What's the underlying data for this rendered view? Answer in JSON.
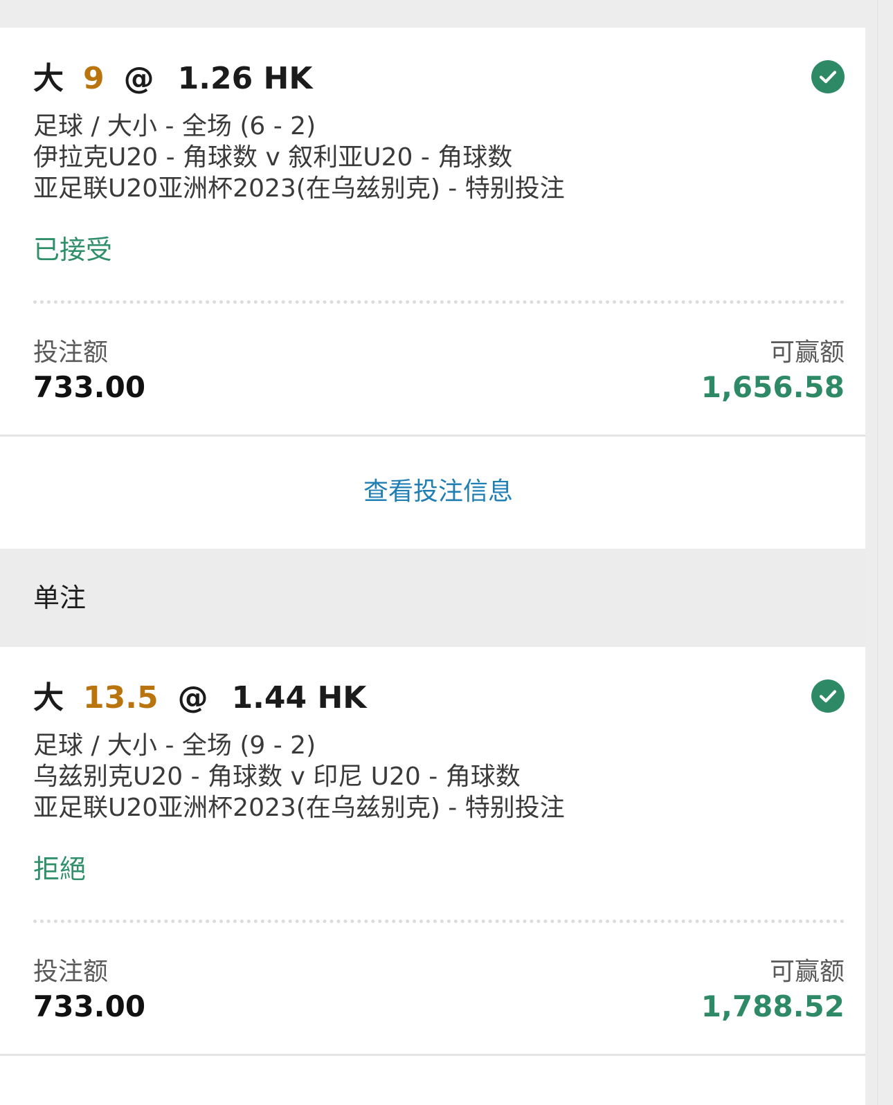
{
  "bets": [
    {
      "selection": "大",
      "line": "9",
      "at": "@",
      "odds": "1.26 HK",
      "desc_lines": [
        "足球 / 大小 - 全场 (6 - 2)",
        "伊拉克U20 - 角球数 v 叙利亚U20 - 角球数",
        "亚足联U20亚洲杯2023(在乌兹别克) - 特别投注"
      ],
      "status": "已接受",
      "stake_label": "投注额",
      "stake_value": "733.00",
      "win_label": "可赢额",
      "win_value": "1,656.58"
    },
    {
      "selection": "大",
      "line": "13.5",
      "at": "@",
      "odds": "1.44 HK",
      "desc_lines": [
        "足球 / 大小 - 全场 (9 - 2)",
        "乌兹别克U20 - 角球数 v 印尼 U20 - 角球数",
        "亚足联U20亚洲杯2023(在乌兹别克) - 特别投注"
      ],
      "status": "拒絕",
      "stake_label": "投注额",
      "stake_value": "733.00",
      "win_label": "可赢额",
      "win_value": "1,788.52"
    }
  ],
  "view_info_link": "查看投注信息",
  "section_title": "单注",
  "icons": {
    "status_icon": "check-circle-icon"
  },
  "colors": {
    "accent_green": "#2e8a66",
    "line_orange": "#b9740d",
    "link_blue": "#1f7fb4"
  }
}
